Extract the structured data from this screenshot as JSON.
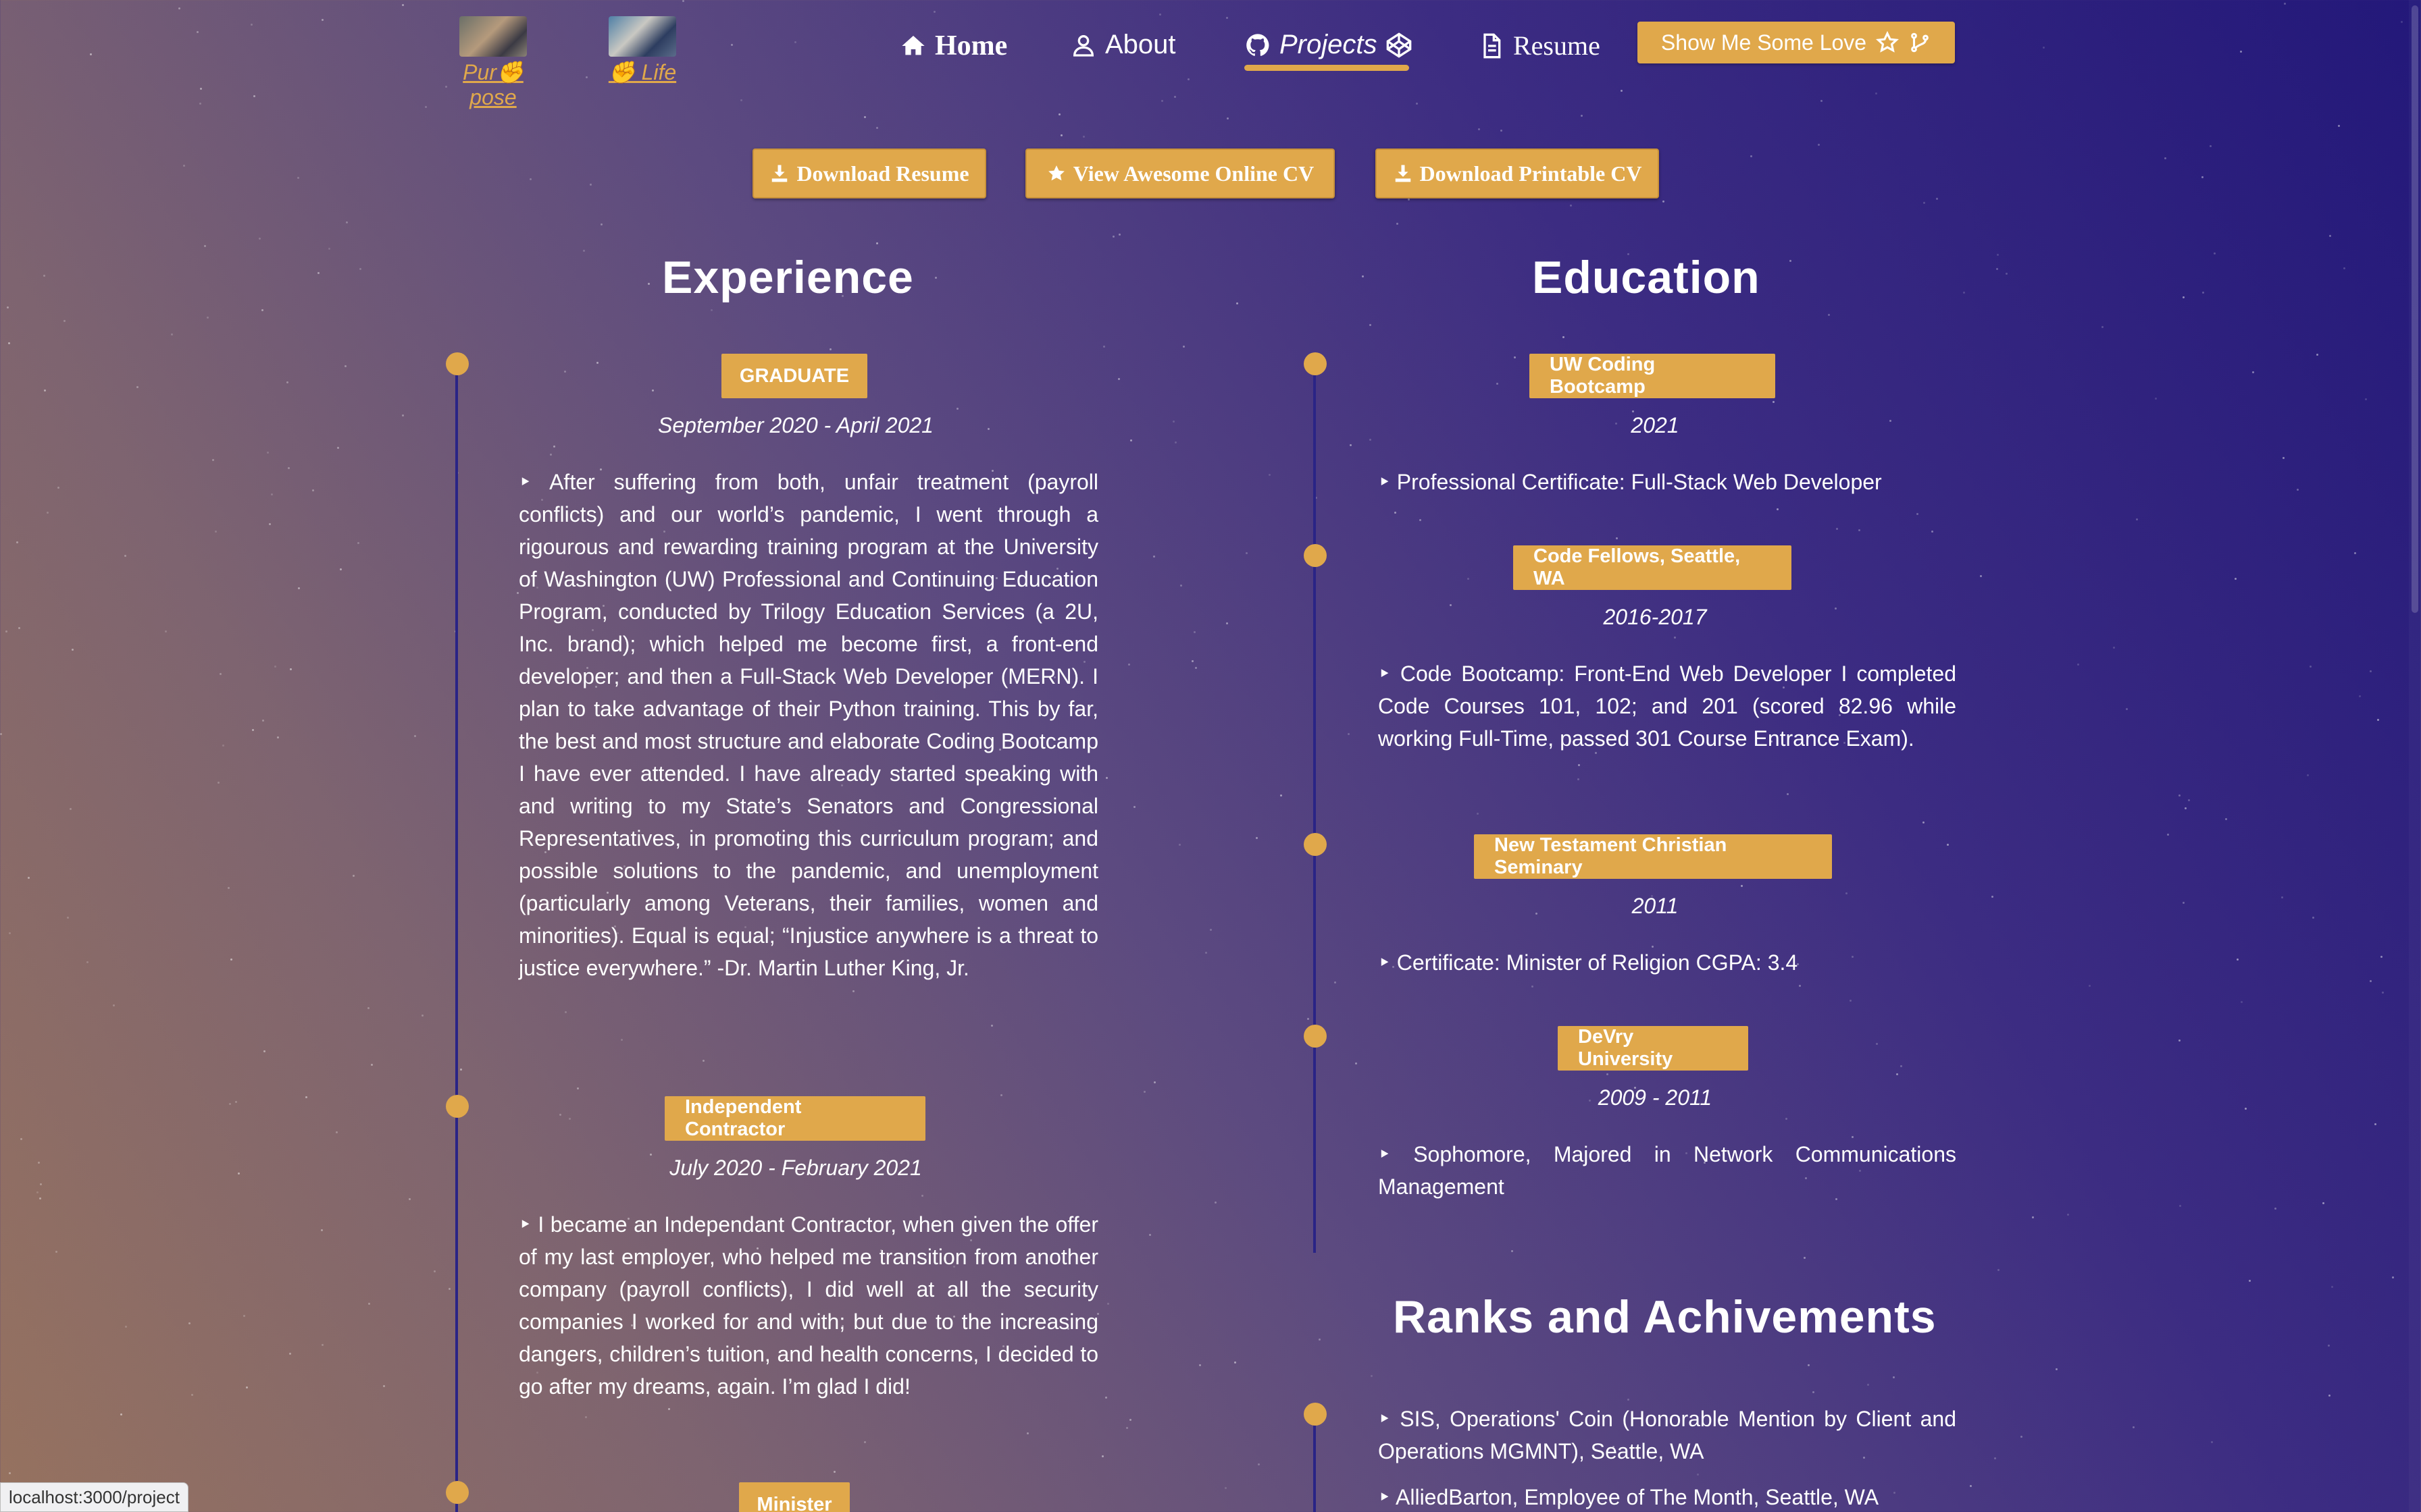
{
  "nav": {
    "purpose_caption": "Pur✊ pose",
    "life_caption": "✊ Life",
    "home": "Home",
    "about": "About",
    "projects": "Projects",
    "resume": "Resume",
    "love_button": "Show Me Some Love"
  },
  "downloads": {
    "resume": "Download Resume",
    "online_cv": "View Awesome Online CV",
    "printable_cv": "Download Printable CV"
  },
  "experience": {
    "title": "Experience",
    "items": [
      {
        "badge": "GRADUATE",
        "date": "September 2020 - April 2021",
        "text": "‣ After suffering from both, unfair treatment (payroll conflicts) and our world’s pandemic, I went through a rigourous and rewarding training program at the University of Washington (UW) Professional and Continuing Education Program, conducted by Trilogy Education Services (a 2U, Inc. brand); which helped me become first, a front-end developer; and then a Full-Stack Web Developer (MERN). I plan to take advantage of their Python training. This by far, the best and most structure and elaborate Coding Bootcamp I have ever attended. I have already started speaking with and writing to my State’s Senators and Congressional Representatives, in promoting this curriculum program; and possible solutions to the pandemic, and unemployment (particularly among Veterans, their families, women and minorities). Equal is equal; “Injustice anywhere is a threat to justice everywhere.” -Dr. Martin Luther King, Jr."
      },
      {
        "badge": "Independent Contractor",
        "date": "July 2020 - February 2021",
        "text": "‣ I became an Independant Contractor, when given the offer of my last employer, who helped me transition from another company (payroll conflicts), I did well at all the security companies I worked for and with; but due to the increasing dangers, children’s tuition, and health concerns, I decided to go after my dreams, again. I’m glad I did!"
      },
      {
        "badge": "Minister",
        "date": "",
        "text": ""
      }
    ]
  },
  "education": {
    "title": "Education",
    "items": [
      {
        "badge": "UW Coding Bootcamp",
        "date": "2021",
        "text": "‣ Professional Certificate: Full-Stack Web Developer"
      },
      {
        "badge": "Code Fellows, Seattle, WA",
        "date": "2016-2017",
        "text": "‣ Code Bootcamp: Front-End Web Developer I completed Code Courses 101, 102; and 201 (scored 82.96 while working Full-Time, passed 301 Course Entrance Exam)."
      },
      {
        "badge": "New Testament Christian Seminary",
        "date": "2011",
        "text": "‣ Certificate: Minister of Religion CGPA: 3.4"
      },
      {
        "badge": "DeVry University",
        "date": "2009 - 2011",
        "text": "‣ Sophomore, Majored in Network Communications Management"
      }
    ]
  },
  "ranks": {
    "title": "Ranks and Achivements",
    "items": [
      "‣ SIS, Operations' Coin (Honorable Mention by Client and Operations MGMNT), Seattle, WA",
      "‣ AlliedBarton, Employee of The Month, Seattle, WA"
    ]
  },
  "status_url": "localhost:3000/project",
  "colors": {
    "accent": "#e0a84b",
    "timeline": "#2a2486"
  }
}
